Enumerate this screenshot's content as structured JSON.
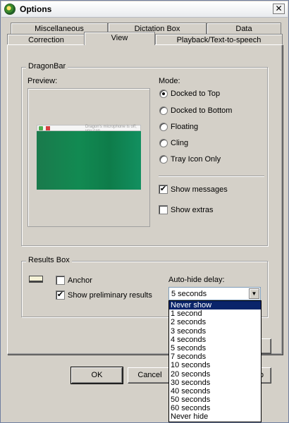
{
  "window": {
    "title": "Options",
    "close_glyph": "✕"
  },
  "tabs_row1": [
    {
      "label": "Miscellaneous"
    },
    {
      "label": "Dictation Box"
    },
    {
      "label": "Data"
    }
  ],
  "tabs_row2": [
    {
      "label": "Correction"
    },
    {
      "label": "View",
      "active": true
    },
    {
      "label": "Playback/Text-to-speech"
    }
  ],
  "dragonbar": {
    "group_label": "DragonBar",
    "preview_label": "Preview:",
    "preview_bar_text": "Dragon's microphone is off; you can...",
    "mode_label": "Mode:",
    "modes": [
      {
        "label": "Docked to Top",
        "checked": true
      },
      {
        "label": "Docked to Bottom",
        "checked": false
      },
      {
        "label": "Floating",
        "checked": false
      },
      {
        "label": "Cling",
        "checked": false
      },
      {
        "label": "Tray Icon Only",
        "checked": false
      }
    ],
    "show_messages": {
      "label": "Show messages",
      "checked": true
    },
    "show_extras": {
      "label": "Show extras",
      "checked": false
    }
  },
  "results_box": {
    "group_label": "Results Box",
    "anchor": {
      "label": "Anchor",
      "checked": false
    },
    "show_preliminary": {
      "label": "Show preliminary results",
      "checked": true
    },
    "autohide_label": "Auto-hide delay:",
    "autohide_value": "5 seconds",
    "options": [
      "Never show",
      "1 second",
      "2 seconds",
      "3 seconds",
      "4 seconds",
      "5 seconds",
      "7 seconds",
      "10 seconds",
      "20 seconds",
      "30 seconds",
      "40 seconds",
      "50 seconds",
      "60 seconds",
      "Never hide"
    ],
    "highlighted_option": "Never show"
  },
  "buttons": {
    "ok": "OK",
    "cancel": "Cancel",
    "help_partial": "p"
  },
  "check_glyph": "✔",
  "colors": {
    "highlight": "#0a246a",
    "preview_green": "#128a52",
    "dialog_bg": "#d4d0c8"
  }
}
